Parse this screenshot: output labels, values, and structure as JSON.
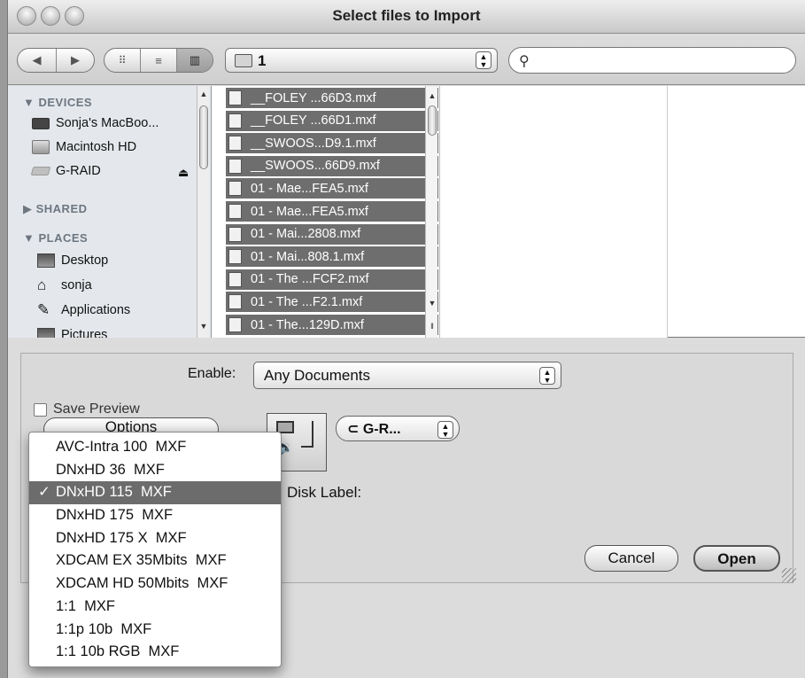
{
  "window": {
    "title": "Select files to Import"
  },
  "toolbar": {
    "back_icon": "back-arrow-icon",
    "forward_icon": "forward-arrow-icon",
    "view_icons": [
      "icon-view",
      "list-view",
      "column-view"
    ],
    "location": "1",
    "search": {
      "value": "",
      "placeholder": ""
    }
  },
  "sidebar": {
    "devices_header": "DEVICES",
    "devices": [
      {
        "label": "Sonja's MacBoo...",
        "icon": "laptop-icon"
      },
      {
        "label": "Macintosh HD",
        "icon": "hard-drive-icon"
      },
      {
        "label": "G-RAID",
        "icon": "external-drive-icon"
      }
    ],
    "shared_header": "SHARED",
    "places_header": "PLACES",
    "places": [
      {
        "label": "Desktop",
        "icon": "desktop-icon"
      },
      {
        "label": "sonja",
        "icon": "home-icon"
      },
      {
        "label": "Applications",
        "icon": "applications-icon"
      },
      {
        "label": "Pictures",
        "icon": "pictures-icon"
      }
    ]
  },
  "files": [
    "__FOLEY ...66D3.mxf",
    "__FOLEY ...66D1.mxf",
    "__SWOOS...D9.1.mxf",
    "__SWOOS...66D9.mxf",
    "01 - Mae...FEA5.mxf",
    "01 - Mae...FEA5.mxf",
    "01 - Mai...2808.mxf",
    "01 - Mai...808.1.mxf",
    "01 - The ...FCF2.mxf",
    "01 - The ...F2.1.mxf",
    "01 - The...129D.mxf"
  ],
  "options": {
    "enable_label": "Enable:",
    "enable_value": "Any Documents",
    "save_preview_label": "Save Preview",
    "options_button": "Options",
    "drive_value": "G-R...",
    "disk_label": "Disk Label:",
    "cancel_button": "Cancel",
    "open_button": "Open"
  },
  "format_menu": {
    "items": [
      "AVC-Intra 100  MXF",
      "DNxHD 36  MXF",
      "DNxHD 115  MXF",
      "DNxHD 175  MXF",
      "DNxHD 175 X  MXF",
      "XDCAM EX 35Mbits  MXF",
      "XDCAM HD 50Mbits  MXF",
      "1:1  MXF",
      "1:1p 10b  MXF",
      "1:1 10b RGB  MXF"
    ],
    "selected_index": 2,
    "check": "✓"
  }
}
